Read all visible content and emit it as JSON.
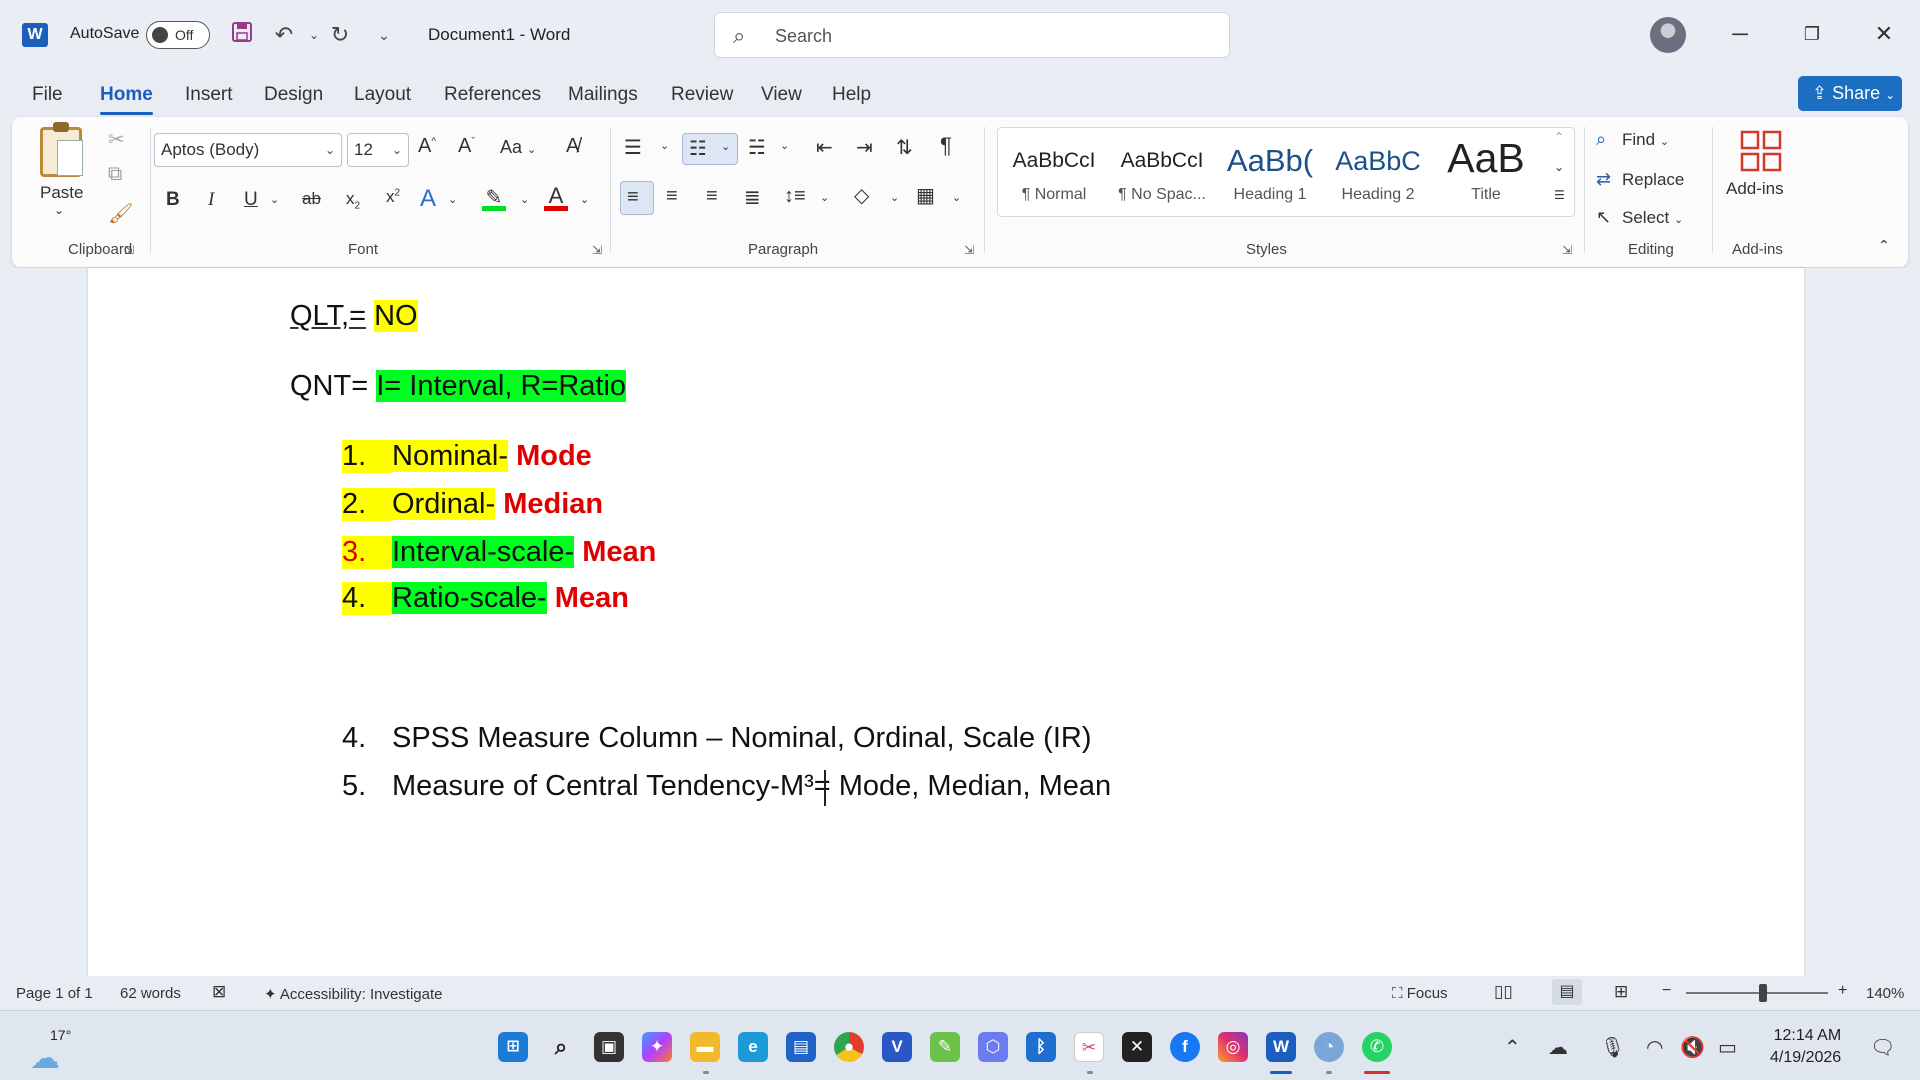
{
  "titlebar": {
    "app_logo": "W",
    "autosave_label": "AutoSave",
    "autosave_state": "Off",
    "document_title": "Document1  -  Word",
    "search_placeholder": "Search",
    "icons": [
      "save-icon",
      "undo-icon",
      "redo-icon",
      "customize-icon",
      "avatar",
      "minimize-icon",
      "restore-icon",
      "close-icon"
    ]
  },
  "menu": {
    "tabs": [
      "File",
      "Home",
      "Insert",
      "Design",
      "Layout",
      "References",
      "Mailings",
      "Review",
      "View",
      "Help"
    ],
    "active_tab": "Home",
    "share_label": "Share"
  },
  "ribbon": {
    "clipboard": {
      "paste_label": "Paste",
      "group_label": "Clipboard"
    },
    "font": {
      "font_name": "Aptos (Body)",
      "font_size": "12",
      "group_label": "Font",
      "case_label": "Aa"
    },
    "paragraph": {
      "group_label": "Paragraph"
    },
    "styles": {
      "group_label": "Styles",
      "items": [
        {
          "sample": "AaBbCcI",
          "name": "¶ Normal"
        },
        {
          "sample": "AaBbCcI",
          "name": "¶ No Spac..."
        },
        {
          "sample": "AaBb(",
          "name": "Heading 1"
        },
        {
          "sample": "AaBbC",
          "name": "Heading 2"
        },
        {
          "sample": "AaB",
          "name": "Title"
        }
      ]
    },
    "editing": {
      "find": "Find",
      "replace": "Replace",
      "select": "Select",
      "group_label": "Editing"
    },
    "addins": {
      "label": "Add-ins",
      "group_label": "Add-ins"
    }
  },
  "document": {
    "line1_prefix": "QLT,=",
    "line1_highlight": "NO",
    "line2_prefix": "QNT=",
    "line2_highlight": "I= Interval, R=Ratio",
    "list_top": [
      {
        "num": "1.",
        "text": "Nominal-",
        "red": "Mode"
      },
      {
        "num": "2.",
        "text": "Ordinal-",
        "red": "Median"
      },
      {
        "num": "3.",
        "text": "Interval-scale-",
        "red": "Mean"
      },
      {
        "num": "4.",
        "text": "Ratio-scale-",
        "red": "Mean"
      }
    ],
    "list_bottom": [
      {
        "num": "4.",
        "text": "SPSS Measure Column – Nominal, Ordinal, Scale (IR)"
      },
      {
        "num": "5.",
        "text": "Measure of Central Tendency-M³= Mode, Median, Mean"
      }
    ]
  },
  "statusbar": {
    "page": "Page 1 of 1",
    "words": "62 words",
    "accessibility": "Accessibility: Investigate",
    "focus": "Focus",
    "zoom": "140%"
  },
  "taskbar": {
    "weather_temp": "17°",
    "time": "12:14 AM",
    "date": "4/19/2026"
  },
  "colors": {
    "accent": "#1b5ebe",
    "highlight_yellow": "#ffff00",
    "highlight_green": "#00ff21",
    "red_text": "#e00000"
  }
}
